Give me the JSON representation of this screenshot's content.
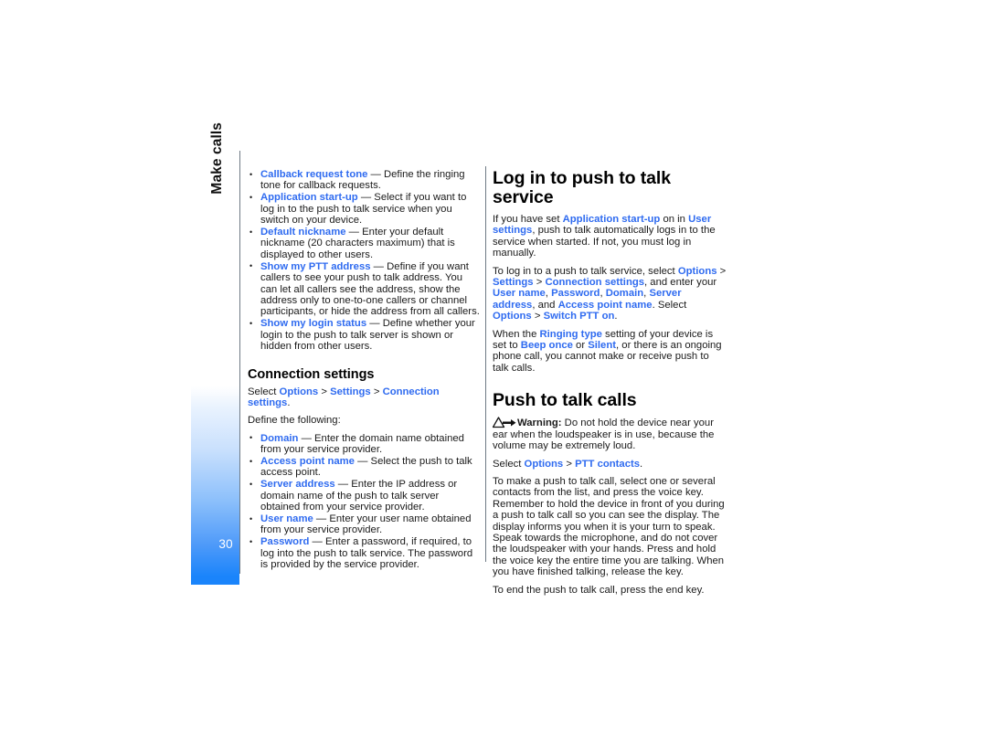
{
  "document": {
    "page_number": "30",
    "chapter_title": "Make calls",
    "accent_link_color": "#2f6bf0",
    "tab_gradient_color": "#1a84fb",
    "text_color": "#1a1a1a"
  },
  "left_column": {
    "settings_list": [
      {
        "term": "Callback request tone",
        "dash": " — ",
        "description": "Define the ringing tone for callback requests."
      },
      {
        "term": "Application start-up",
        "dash": " — ",
        "description": "Select if you want to log in to the push to talk service when you switch on your device."
      },
      {
        "term": "Default nickname",
        "dash": " — ",
        "description": "Enter your default nickname (20 characters maximum) that is displayed to other users."
      },
      {
        "term": "Show my PTT address",
        "dash": " — ",
        "description": "Define if you want callers to see your push to talk address. You can let all callers see the address, show the address only to one-to-one callers or channel participants, or hide the address from all callers."
      },
      {
        "term": "Show my login status",
        "dash": " — ",
        "description": "Define whether your login to the push to talk server is shown or hidden from other users."
      }
    ],
    "connection_settings": {
      "heading": "Connection settings",
      "select_prefix": "Select ",
      "path": [
        "Options",
        "Settings",
        "Connection settings"
      ],
      "select_suffix": ".",
      "intro": "Define the following:",
      "items": [
        {
          "term": "Domain",
          "dash": " — ",
          "description": "Enter the domain name obtained from your service provider."
        },
        {
          "term": "Access point name",
          "dash": " — ",
          "description": "Select the push to talk access point."
        },
        {
          "term": "Server address",
          "dash": " — ",
          "description": "Enter the IP address or domain name of the push to talk server obtained from your service provider."
        },
        {
          "term": "User name",
          "dash": " — ",
          "description": "Enter your user name obtained from your service provider."
        },
        {
          "term": "Password",
          "dash": " — ",
          "description": "Enter a password, if required, to log into the push to talk service. The password is provided by the service provider."
        }
      ]
    }
  },
  "right_column": {
    "login_section": {
      "heading": "Log in to push to talk service",
      "p1": {
        "a": "If you have set ",
        "link1": "Application start-up",
        "b": " on in ",
        "link2": "User settings",
        "c": ", push to talk automatically logs in to the service when started. If not, you must log in manually."
      },
      "p2": {
        "a": "To log in to a push to talk service, select ",
        "link1": "Options",
        "sep1": " > ",
        "link2": "Settings",
        "sep2": " > ",
        "link3": "Connection settings",
        "b": ", and enter your ",
        "link4": "User name",
        "c": ", ",
        "link5": "Password",
        "d": ", ",
        "link6": "Domain",
        "e": ", ",
        "link7": "Server address",
        "f": ", and ",
        "link8": "Access point name",
        "g": ". Select ",
        "link9": "Options",
        "sep3": " > ",
        "link10": "Switch PTT on",
        "h": "."
      },
      "p3": {
        "a": "When the ",
        "link1": "Ringing type",
        "b": " setting of your device is set to ",
        "link2": "Beep once",
        "c": " or ",
        "link3": "Silent",
        "d": ", or there is an ongoing phone call, you cannot make or receive push to talk calls."
      }
    },
    "calls_section": {
      "heading": "Push to talk calls",
      "warning_icon": "warning-triangle-icon",
      "warning_label": "Warning:",
      "warning_text": " Do not hold the device near your ear when the loudspeaker is in use, because the volume may be extremely loud.",
      "select_line": {
        "a": "Select ",
        "link1": "Options",
        "sep": " > ",
        "link2": "PTT contacts",
        "b": "."
      },
      "body": "To make a push to talk call, select one or several contacts from the list, and press the voice key. Remember to hold the device in front of you during a push to talk call so you can see the display. The display informs you when it is your turn to speak. Speak towards the microphone, and do not cover the loudspeaker with your hands. Press and hold the voice key the entire time you are talking. When you have finished talking, release the key.",
      "closing": "To end the push to talk call, press the end key."
    }
  }
}
